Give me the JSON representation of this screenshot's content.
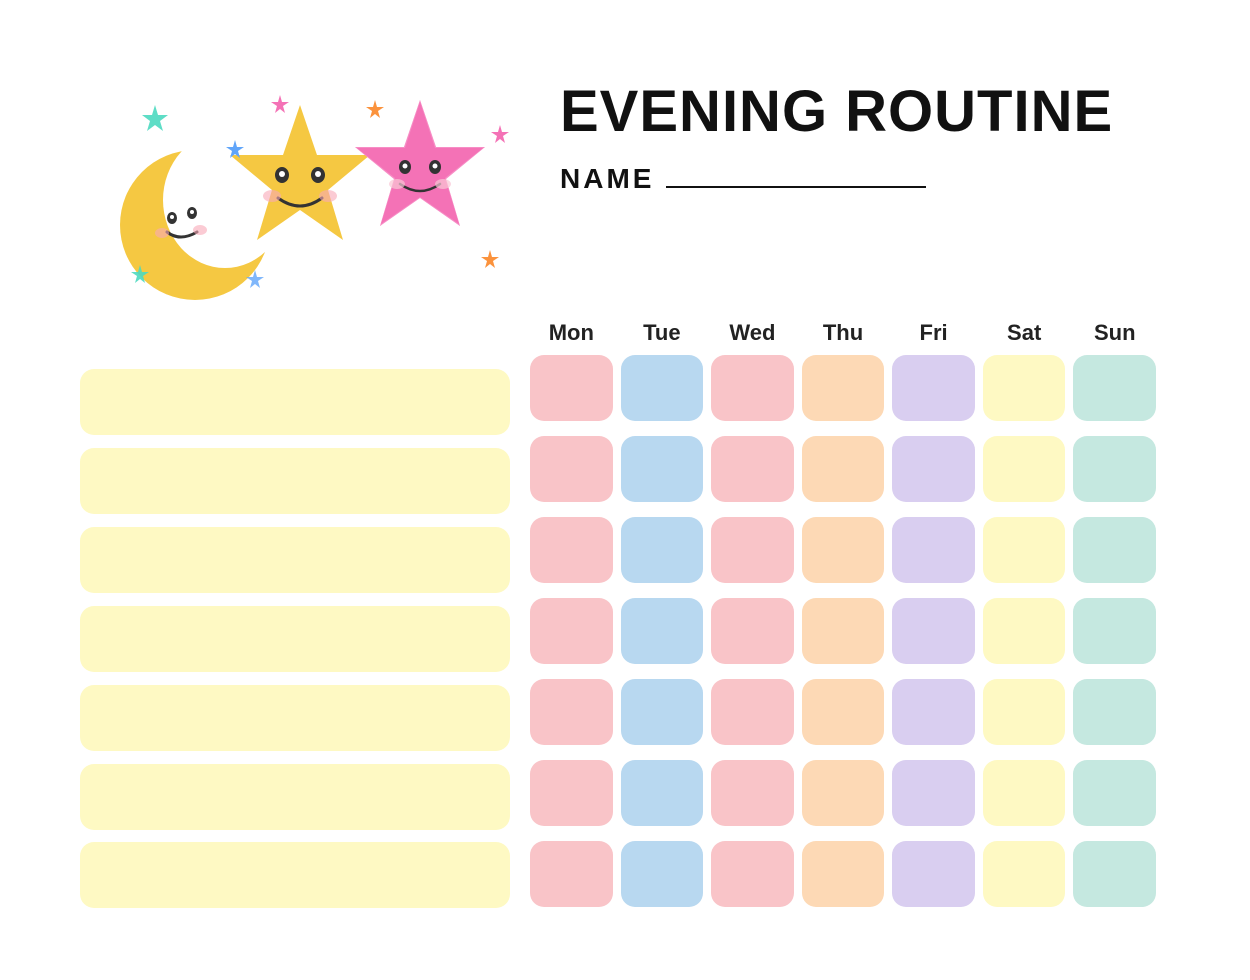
{
  "header": {
    "title": "EVENING ROUTINE",
    "name_label": "NAME"
  },
  "days": {
    "labels": [
      "Mon",
      "Tue",
      "Wed",
      "Thu",
      "Fri",
      "Sat",
      "Sun"
    ]
  },
  "tasks": {
    "rows": 7,
    "color": "#fef9c3"
  },
  "colors": {
    "mon": "#f9c4c8",
    "tue": "#b8d8f0",
    "wed": "#f9c4c8",
    "thu": "#fdd9b5",
    "fri": "#d9cef0",
    "sat": "#fef9c3",
    "sun": "#c5e8e0",
    "task": "#fef9c3"
  }
}
